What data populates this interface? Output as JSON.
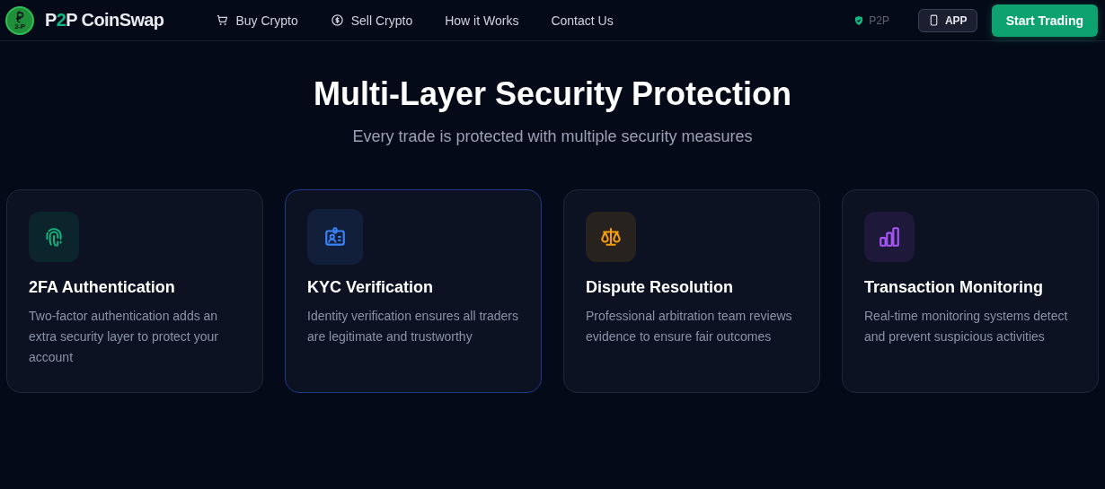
{
  "header": {
    "logo_mark": "2-P",
    "brand": {
      "lead": "P",
      "accent": "2",
      "tail": "P CoinSwap"
    },
    "nav": [
      {
        "label": "Buy Crypto",
        "kind": "icon-link"
      },
      {
        "label": "Sell Crypto",
        "kind": "icon-link"
      },
      {
        "label": "How it Works",
        "kind": "link"
      },
      {
        "label": "Contact Us",
        "kind": "link"
      }
    ],
    "badge": "P2P",
    "app_button": "APP",
    "cta": "Start Trading"
  },
  "section": {
    "title": "Multi-Layer Security Protection",
    "subtitle": "Every trade is protected with multiple security measures",
    "cards": [
      {
        "title": "2FA Authentication",
        "text": "Two-factor authentication adds an extra security layer to protect your account",
        "color": "#10b981",
        "highlighted": false
      },
      {
        "title": "KYC Verification",
        "text": "Identity verification ensures all traders are legitimate and trustworthy",
        "color": "#3b82f6",
        "highlighted": true
      },
      {
        "title": "Dispute Resolution",
        "text": "Professional arbitration team reviews evidence to ensure fair outcomes",
        "color": "#f59e0b",
        "highlighted": false
      },
      {
        "title": "Transaction Monitoring",
        "text": "Real-time monitoring systems detect and prevent suspicious activities",
        "color": "#a855f7",
        "highlighted": false
      }
    ]
  }
}
